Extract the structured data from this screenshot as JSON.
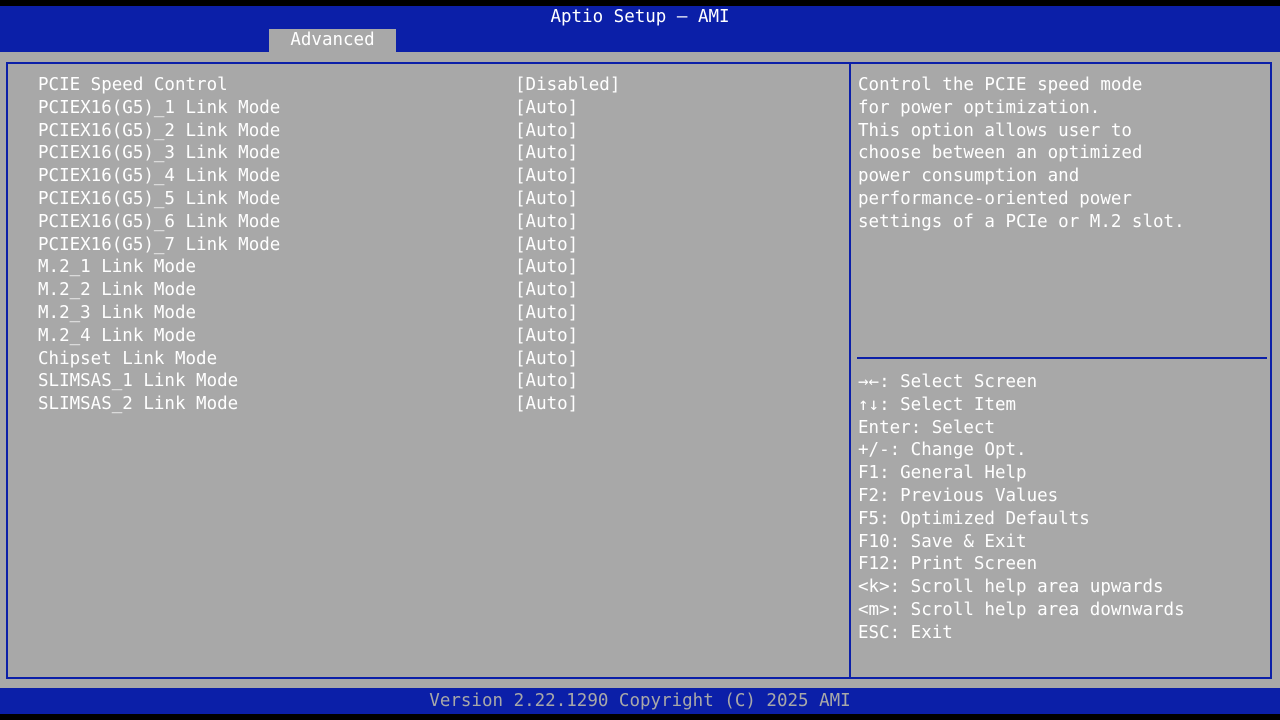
{
  "header": {
    "title": "Aptio Setup – AMI",
    "active_tab": "Advanced"
  },
  "settings": [
    {
      "label": "PCIE Speed Control",
      "value": "[Disabled]"
    },
    {
      "label": "PCIEX16(G5)_1 Link Mode",
      "value": "[Auto]"
    },
    {
      "label": "PCIEX16(G5)_2 Link Mode",
      "value": "[Auto]"
    },
    {
      "label": "PCIEX16(G5)_3 Link Mode",
      "value": "[Auto]"
    },
    {
      "label": "PCIEX16(G5)_4 Link Mode",
      "value": "[Auto]"
    },
    {
      "label": "PCIEX16(G5)_5 Link Mode",
      "value": "[Auto]"
    },
    {
      "label": "PCIEX16(G5)_6 Link Mode",
      "value": "[Auto]"
    },
    {
      "label": "PCIEX16(G5)_7 Link Mode",
      "value": "[Auto]"
    },
    {
      "label": "M.2_1 Link Mode",
      "value": "[Auto]"
    },
    {
      "label": "M.2_2 Link Mode",
      "value": "[Auto]"
    },
    {
      "label": "M.2_3 Link Mode",
      "value": "[Auto]"
    },
    {
      "label": "M.2_4 Link Mode",
      "value": "[Auto]"
    },
    {
      "label": "Chipset Link Mode",
      "value": "[Auto]"
    },
    {
      "label": "SLIMSAS_1 Link Mode",
      "value": "[Auto]"
    },
    {
      "label": "SLIMSAS_2 Link Mode",
      "value": "[Auto]"
    }
  ],
  "help": {
    "lines": [
      "Control the PCIE speed mode",
      "for power optimization.",
      "This option allows user to",
      "choose between an optimized",
      "power consumption and",
      "performance-oriented power",
      "settings of a PCIe or M.2 slot."
    ]
  },
  "keys": [
    {
      "key": "→←",
      "desc": ": Select Screen"
    },
    {
      "key": "↑↓",
      "desc": ": Select Item"
    },
    {
      "key": "Enter",
      "desc": ": Select"
    },
    {
      "key": "+/-",
      "desc": ": Change Opt."
    },
    {
      "key": "F1",
      "desc": ": General Help"
    },
    {
      "key": "F2",
      "desc": ": Previous Values"
    },
    {
      "key": "F5",
      "desc": ": Optimized Defaults"
    },
    {
      "key": "F10",
      "desc": ": Save & Exit"
    },
    {
      "key": "F12",
      "desc": ": Print Screen"
    },
    {
      "key": "<k>",
      "desc": ": Scroll help area upwards"
    },
    {
      "key": "<m>",
      "desc": ": Scroll help area downwards"
    },
    {
      "key": "ESC",
      "desc": ": Exit"
    }
  ],
  "footer": {
    "text": "Version 2.22.1290 Copyright (C) 2025 AMI"
  },
  "colors": {
    "bar_blue": "#0b1fa8",
    "panel_gray": "#a8a8a8",
    "text_white": "#ffffff"
  }
}
